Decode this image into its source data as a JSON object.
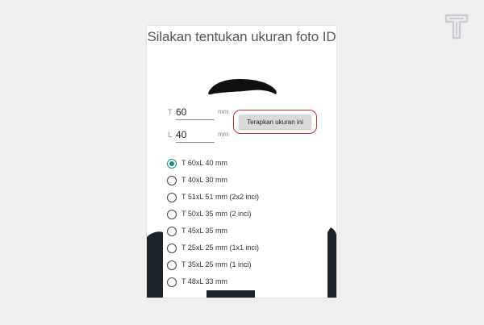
{
  "title": "Silakan tentukan ukuran foto ID",
  "fields": {
    "height": {
      "prefix": "T",
      "value": "60",
      "unit": "mm"
    },
    "width": {
      "prefix": "L",
      "value": "40",
      "unit": "mm"
    }
  },
  "apply_button": {
    "label": "Terapkan ukuran ini"
  },
  "size_options": [
    {
      "label": "T 60xL 40 mm",
      "selected": true
    },
    {
      "label": "T 40xL 30 mm",
      "selected": false
    },
    {
      "label": "T 51xL 51 mm (2x2 inci)",
      "selected": false
    },
    {
      "label": "T 50xL 35 mm (2 inci)",
      "selected": false
    },
    {
      "label": "T 45xL 35 mm",
      "selected": false
    },
    {
      "label": "T 25xL 25 mm (1x1 inci)",
      "selected": false
    },
    {
      "label": "T 35xL 25 mm (1 inci)",
      "selected": false
    },
    {
      "label": "T 48xL 33 mm",
      "selected": false
    }
  ],
  "colors": {
    "accent": "#15907e",
    "highlight": "#d02b2b",
    "background": "#efefef"
  },
  "icons": {
    "watermark": "logo-icon",
    "photo": "portrait-silhouette"
  }
}
